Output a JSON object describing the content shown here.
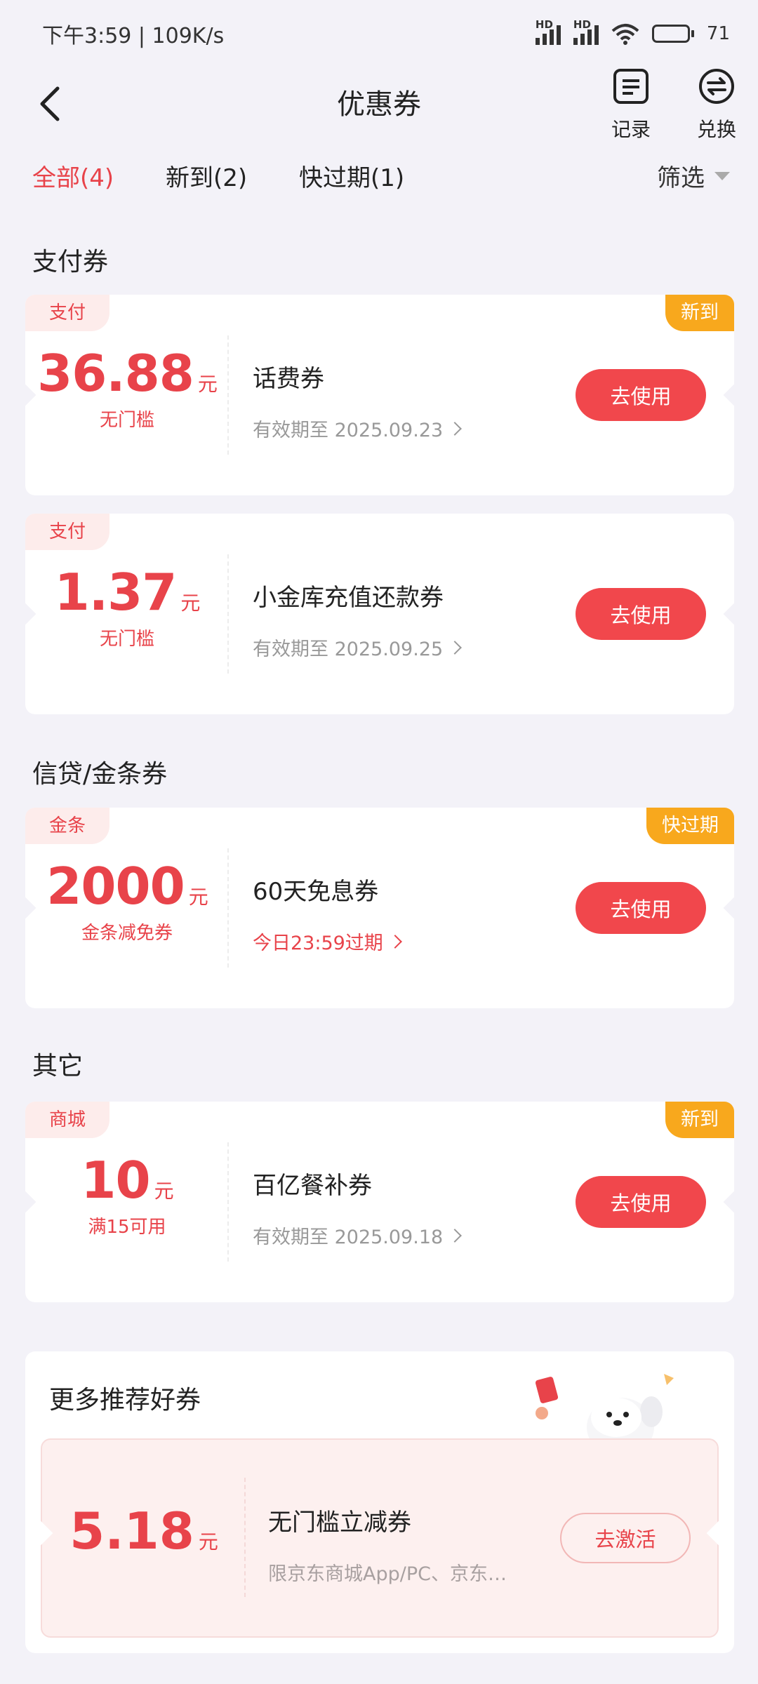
{
  "status_bar": {
    "time_speed": "下午3:59 | 109K/s",
    "network_label_1": "HD",
    "network_label_2": "HD",
    "battery": "71",
    "battery_level": 0.71
  },
  "header": {
    "title": "优惠券",
    "actions": [
      {
        "label": "记录",
        "icon": "record-icon"
      },
      {
        "label": "兑换",
        "icon": "exchange-icon"
      }
    ]
  },
  "tabs": [
    {
      "label": "全部(4)",
      "active": true
    },
    {
      "label": "新到(2)",
      "active": false
    },
    {
      "label": "快过期(1)",
      "active": false
    }
  ],
  "filter_label": "筛选",
  "colors": {
    "accent": "#e8434a",
    "badge": "#f8a81d",
    "background": "#f3f2f8"
  },
  "sections": [
    {
      "title": "支付券",
      "coupons": [
        {
          "tag": "支付",
          "badge": "新到",
          "amount": "36.88",
          "unit": "元",
          "condition": "无门槛",
          "name": "话费券",
          "validity": "有效期至 2025.09.23",
          "button": "去使用"
        },
        {
          "tag": "支付",
          "badge": "",
          "amount": "1.37",
          "unit": "元",
          "condition": "无门槛",
          "name": "小金库充值还款券",
          "validity": "有效期至 2025.09.25",
          "button": "去使用"
        }
      ]
    },
    {
      "title": "信贷/金条券",
      "coupons": [
        {
          "tag": "金条",
          "badge": "快过期",
          "amount": "2000",
          "unit": "元",
          "condition": "金条减免券",
          "name": "60天免息券",
          "validity": "今日23:59过期",
          "button": "去使用"
        }
      ]
    },
    {
      "title": "其它",
      "coupons": [
        {
          "tag": "商城",
          "badge": "新到",
          "amount": "10",
          "unit": "元",
          "condition": "满15可用",
          "name": "百亿餐补券",
          "validity": "有效期至 2025.09.18",
          "button": "去使用"
        }
      ]
    }
  ],
  "recommend": {
    "title": "更多推荐好券",
    "coupon": {
      "amount": "5.18",
      "unit": "元",
      "name": "无门槛立减券",
      "desc": "限京东商城App/PC、京东小程序使用",
      "button": "去激活"
    }
  }
}
